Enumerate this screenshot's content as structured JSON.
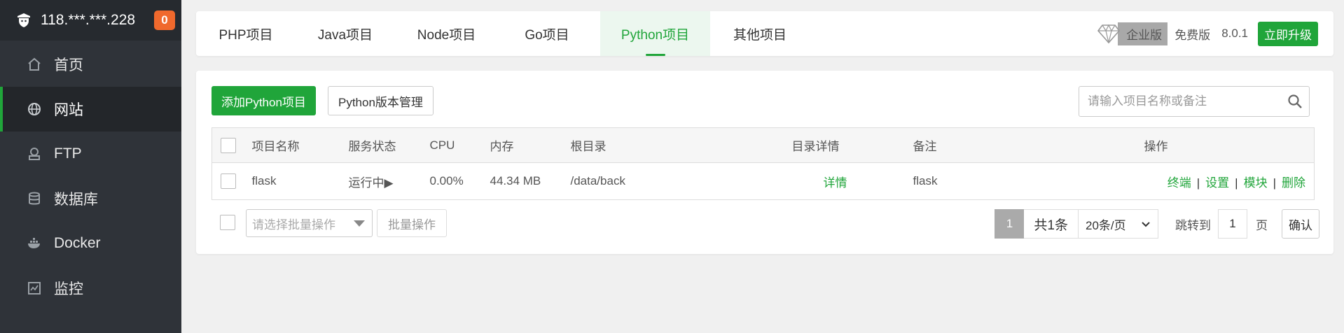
{
  "sidebar": {
    "header": {
      "ip": "118.***.***.228",
      "badge": "0"
    },
    "items": [
      {
        "label": "首页",
        "icon": "home-icon"
      },
      {
        "label": "网站",
        "icon": "globe-icon",
        "active": true
      },
      {
        "label": "FTP",
        "icon": "ftp-icon"
      },
      {
        "label": "数据库",
        "icon": "database-icon"
      },
      {
        "label": "Docker",
        "icon": "docker-icon"
      },
      {
        "label": "监控",
        "icon": "monitor-icon"
      }
    ]
  },
  "tabs": [
    {
      "label": "PHP项目"
    },
    {
      "label": "Java项目"
    },
    {
      "label": "Node项目"
    },
    {
      "label": "Go项目"
    },
    {
      "label": "Python项目",
      "active": true
    },
    {
      "label": "其他项目"
    }
  ],
  "version": {
    "enterprise": "企业版",
    "free": "免费版",
    "number": "8.0.1",
    "upgrade": "立即升级"
  },
  "toolbar": {
    "add_label": "添加Python项目",
    "manage_label": "Python版本管理",
    "search_placeholder": "请输入项目名称或备注"
  },
  "table": {
    "headers": [
      "项目名称",
      "服务状态",
      "CPU",
      "内存",
      "根目录",
      "目录详情",
      "备注",
      "操作"
    ],
    "rows": [
      {
        "name": "flask",
        "status": "运行中▶",
        "cpu": "0.00%",
        "memory": "44.34 MB",
        "root": "/data/back",
        "detail": "详情",
        "note": "flask",
        "actions": [
          "终端",
          "设置",
          "模块",
          "删除"
        ]
      }
    ]
  },
  "footer": {
    "batch_placeholder": "请选择批量操作",
    "batch_button": "批量操作",
    "page_current": "1",
    "total": "共1条",
    "page_size": "20条/页",
    "jump_label": "跳转到",
    "jump_value": "1",
    "page_unit": "页",
    "confirm": "确认"
  },
  "colors": {
    "accent": "#20a53a",
    "sidebar_bg": "#2f3339",
    "badge": "#f0692d"
  }
}
